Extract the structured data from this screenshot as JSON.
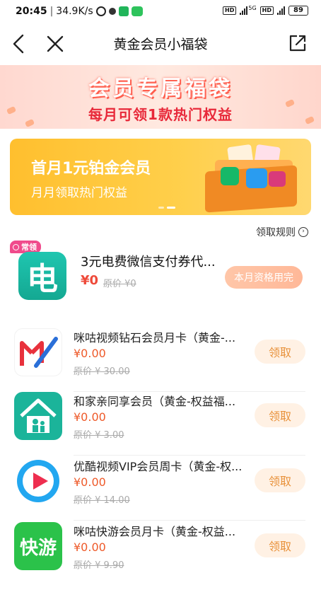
{
  "status_bar": {
    "time": "20:45",
    "net_speed": "34.9K/s",
    "network": "5G",
    "battery": "89",
    "icons": [
      "alarm-icon",
      "dot-icon",
      "app-icon",
      "wechat-icon",
      "hd-icon",
      "signal-icon",
      "hd-icon",
      "signal-icon",
      "battery-icon"
    ]
  },
  "nav": {
    "title": "黄金会员小福袋",
    "icons": [
      "back-icon",
      "close-icon",
      "share-icon"
    ]
  },
  "banner": {
    "title": "会员专属福袋",
    "subtitle": "每月可领1款热门权益"
  },
  "promo": {
    "title": "首月1元铂金会员",
    "subtitle": "月月领取热门权益",
    "active_slide_index": 1,
    "slide_count": 2
  },
  "rules_link": "领取规则",
  "featured": {
    "badge": "常领",
    "icon_text": "电",
    "title": "3元电费微信支付券代...",
    "price": "¥0",
    "original_price": "原价 ¥0",
    "button": "本月资格用完"
  },
  "items": [
    {
      "title": "咪咕视频钻石会员月卡（黄金-...",
      "price": "¥0.00",
      "original_price": "原价 ¥ 30.00",
      "button": "领取",
      "icon": "migu-video-icon"
    },
    {
      "title": "和家亲同享会员（黄金-权益福...",
      "price": "¥0.00",
      "original_price": "原价 ¥ 3.00",
      "button": "领取",
      "icon": "hejiaqin-icon"
    },
    {
      "title": "优酷视频VIP会员周卡（黄金-权...",
      "price": "¥0.00",
      "original_price": "原价 ¥ 14.00",
      "button": "领取",
      "icon": "youku-icon"
    },
    {
      "title": "咪咕快游会员月卡（黄金-权益...",
      "price": "¥0.00",
      "original_price": "原价 ¥ 9.90",
      "button": "领取",
      "icon": "migu-kuaiyou-icon",
      "icon_text": "快游"
    }
  ],
  "colors": {
    "price_red": "#ee4a3a",
    "promo_yellow": "#ffc53a",
    "claim_bg": "#fff1e4",
    "claim_text": "#e8913a"
  }
}
